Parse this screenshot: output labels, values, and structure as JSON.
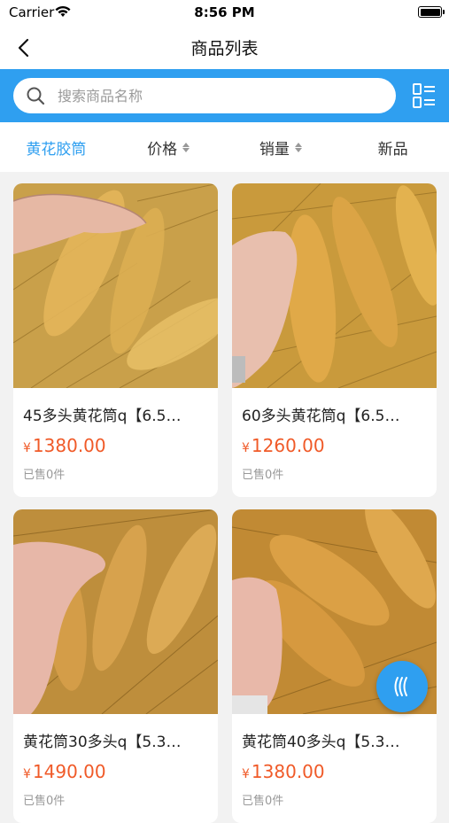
{
  "status_bar": {
    "carrier": "Carrier",
    "time": "8:56 PM"
  },
  "nav": {
    "title": "商品列表"
  },
  "search": {
    "placeholder": "搜索商品名称"
  },
  "filters": [
    {
      "label": "黄花胶筒",
      "active": true
    },
    {
      "label": "价格",
      "sortable": true
    },
    {
      "label": "销量",
      "sortable": true
    },
    {
      "label": "新品"
    }
  ],
  "products": [
    {
      "name": "45多头黄花筒q【6.5…",
      "currency": "¥",
      "price": "1380.00",
      "sold": "已售0件"
    },
    {
      "name": "60多头黄花筒q【6.5…",
      "currency": "¥",
      "price": "1260.00",
      "sold": "已售0件"
    },
    {
      "name": "黄花筒30多头q【5.3…",
      "currency": "¥",
      "price": "1490.00",
      "sold": "已售0件"
    },
    {
      "name": "黄花筒40多头q【5.3…",
      "currency": "¥",
      "price": "1380.00",
      "sold": "已售0件"
    }
  ],
  "colors": {
    "accent": "#2f9ff0",
    "price": "#f05a28"
  }
}
